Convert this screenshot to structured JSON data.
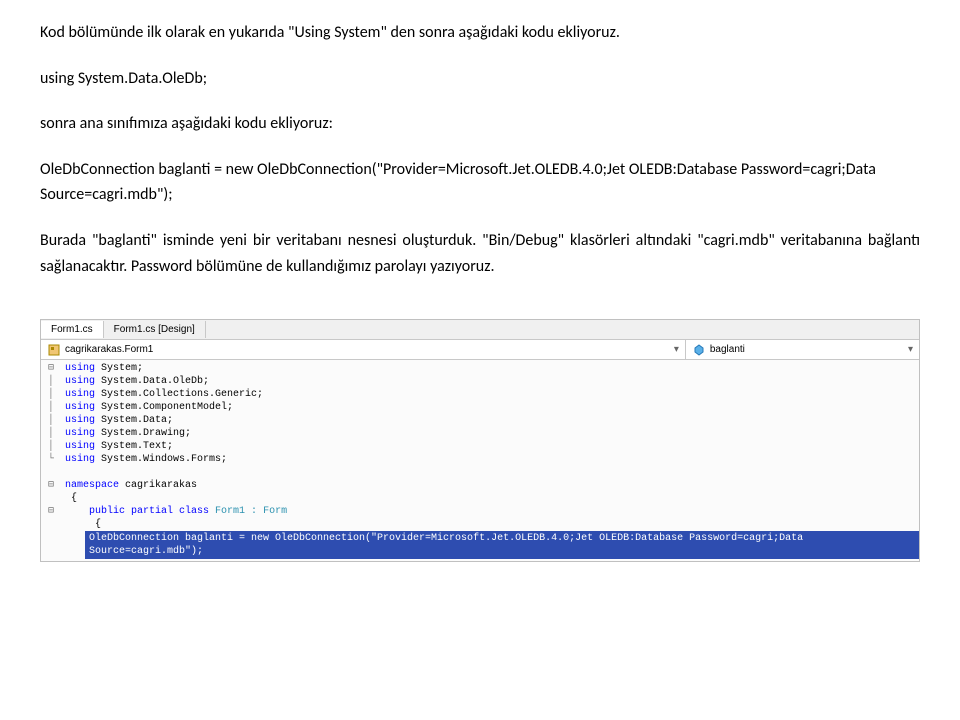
{
  "para1": "Kod bölümünde ilk olarak en yukarıda \"Using System\" den sonra aşağıdaki kodu ekliyoruz.",
  "using_line": "using System.Data.OleDb;",
  "para2": "sonra ana sınıfımıza aşağıdaki kodu ekliyoruz:",
  "conn_line": "OleDbConnection baglanti = new OleDbConnection(\"Provider=Microsoft.Jet.OLEDB.4.0;Jet OLEDB:Database Password=cagri;Data Source=cagri.mdb\");",
  "para3": "Burada \"baglanti\" isminde yeni bir veritabanı nesnesi oluşturduk. \"Bin/Debug\" klasörleri altındaki \"cagri.mdb\" veritabanına bağlantı sağlanacaktır. Password bölümüne de kullandığımız parolayı yazıyoruz.",
  "tabs": {
    "active": "Form1.cs",
    "inactive": "Form1.cs [Design]"
  },
  "dropdown_left": "cagrikarakas.Form1",
  "dropdown_right": "baglanti",
  "code": {
    "l1": "using",
    "l1b": " System;",
    "l2": "using",
    "l2b": " System.Data.OleDb;",
    "l3": "using",
    "l3b": " System.Collections.Generic;",
    "l4": "using",
    "l4b": " System.ComponentModel;",
    "l5": "using",
    "l5b": " System.Data;",
    "l6": "using",
    "l6b": " System.Drawing;",
    "l7": "using",
    "l7b": " System.Text;",
    "l8": "using",
    "l8b": " System.Windows.Forms;",
    "ns": "namespace",
    "nsn": " cagrikarakas",
    "pub": "public partial class",
    "frm": " Form1 : ",
    "frmtype": "Form",
    "highlight": "OleDbConnection baglanti = new OleDbConnection(\"Provider=Microsoft.Jet.OLEDB.4.0;Jet OLEDB:Database Password=cagri;Data Source=cagri.mdb\");"
  },
  "glyphs": {
    "minus": "⊟",
    "pipe": "│",
    "corner": "└"
  }
}
